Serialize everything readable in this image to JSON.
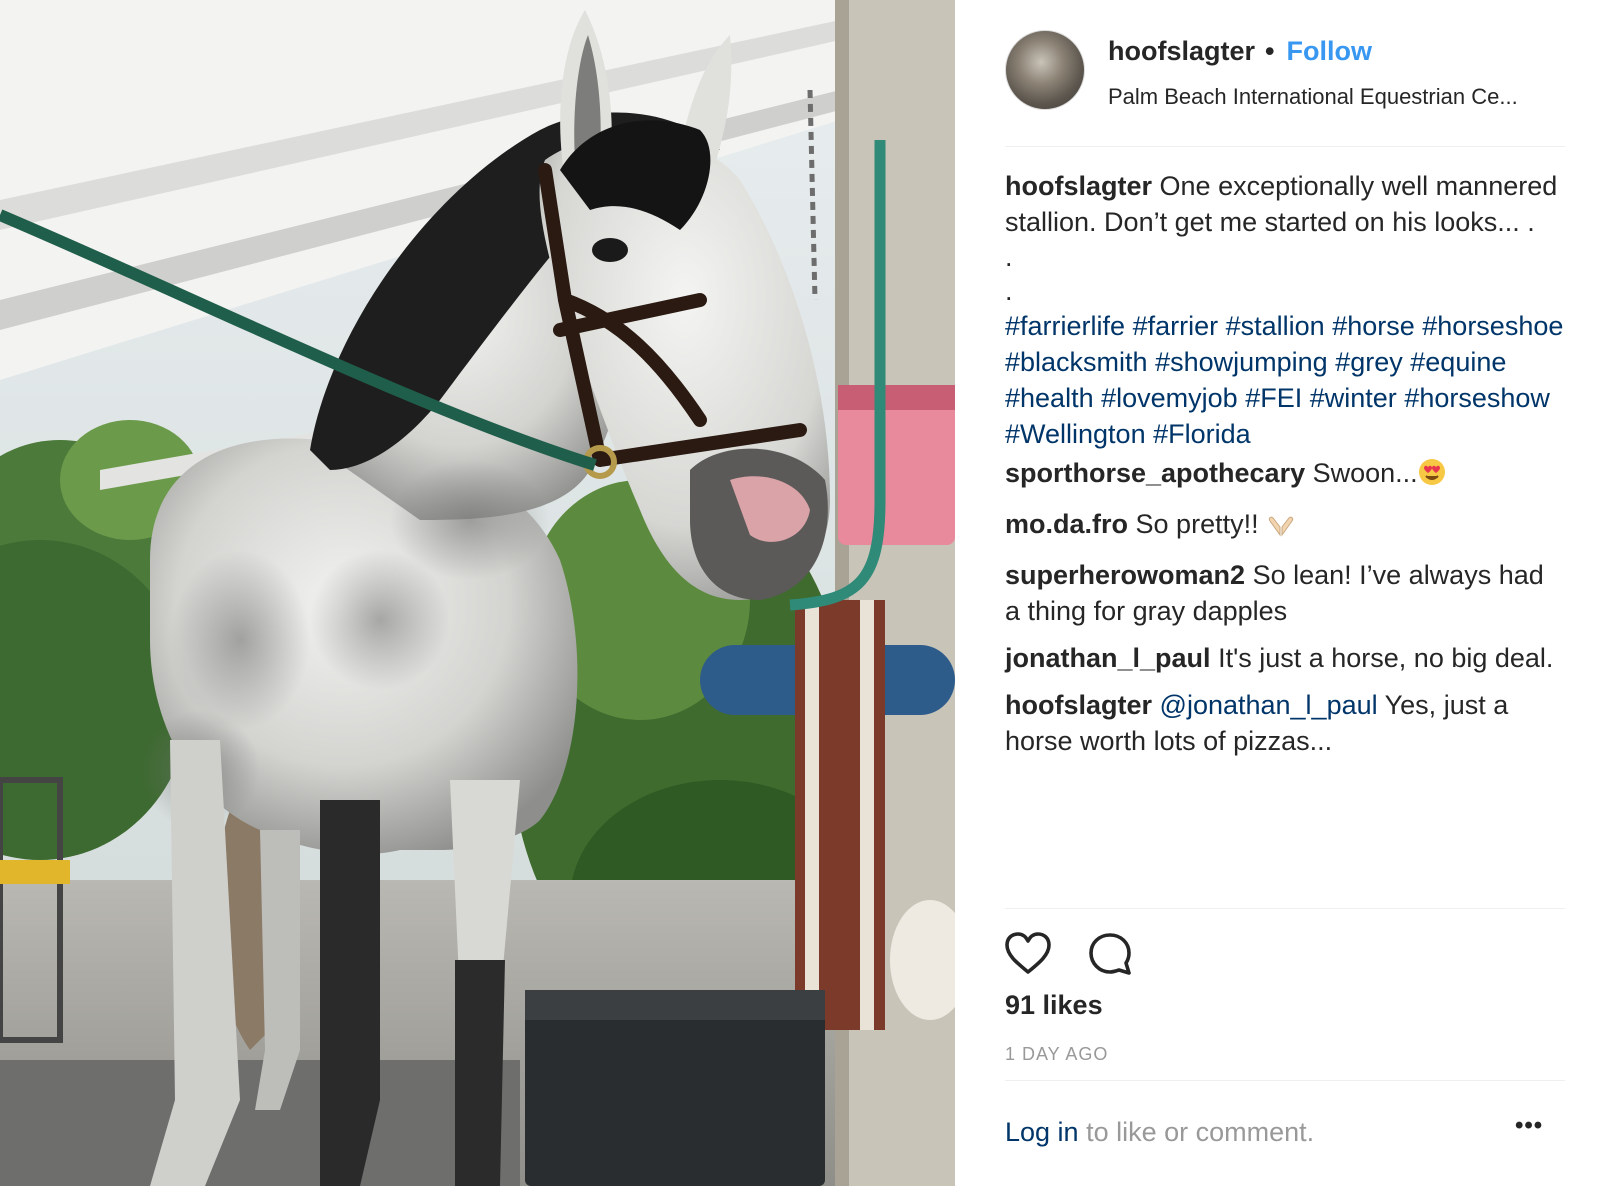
{
  "header": {
    "username": "hoofslagter",
    "separator": "•",
    "follow_label": "Follow",
    "location": "Palm Beach International Equestrian Ce..."
  },
  "comments": {
    "caption": {
      "user": "hoofslagter",
      "text": "One exceptionally well mannered stallion. Don’t get me started on his looks... .",
      "dot1": ".",
      "dot2": ".",
      "hashtags": [
        "#farrierlife",
        "#farrier",
        "#stallion",
        "#horse",
        "#horseshoe",
        "#blacksmith",
        "#showjumping",
        "#grey",
        "#equine",
        "#health",
        "#lovemyjob",
        "#FEI",
        "#winter",
        "#horseshow",
        "#Wellington",
        "#Florida"
      ]
    },
    "list": [
      {
        "user": "sporthorse_apothecary",
        "text": "Swoon...",
        "emoji": "heart-eyes-emoji"
      },
      {
        "user": "mo.da.fro",
        "text": "So pretty!!",
        "emoji": "praying-hands-emoji"
      },
      {
        "user": "superherowoman2",
        "text": "So lean! I’ve always had a thing for gray dapples"
      },
      {
        "user": "jonathan_l_paul",
        "text": "It's just a horse, no big deal."
      },
      {
        "user": "hoofslagter",
        "mention": "@jonathan_l_paul",
        "text": "Yes, just a horse worth lots of pizzas..."
      }
    ]
  },
  "actions": {
    "like_icon": "heart-icon",
    "comment_icon": "comment-icon"
  },
  "likes": "91 likes",
  "timestamp": "1 DAY AGO",
  "login": {
    "link": "Log in",
    "rest": "to like or comment."
  },
  "more_label": "•••",
  "colors": {
    "follow": "#3897f0",
    "hashtag": "#003569",
    "muted": "#999999",
    "text": "#262626"
  }
}
